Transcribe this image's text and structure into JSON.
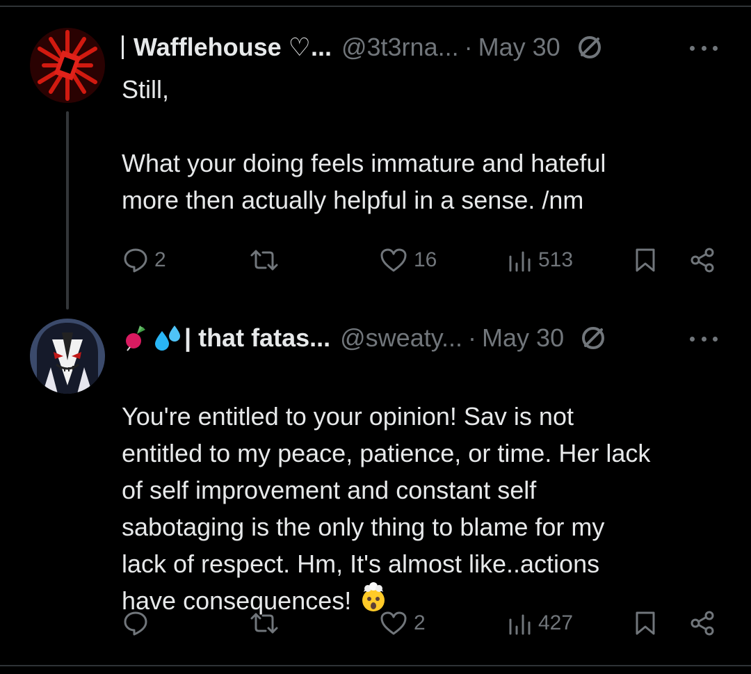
{
  "posts": [
    {
      "name": "Wafflehouse ♡...",
      "handle": "@3t3rna...",
      "separator": "·",
      "date": "May 30",
      "text": "Still,\n\nWhat your doing feels immature and hateful\nmore then actually helpful in a sense. /nm",
      "replies": "2",
      "reposts": "",
      "likes": "16",
      "views": "513"
    },
    {
      "name": "| that fatas...",
      "handle": "@sweaty...",
      "separator": "·",
      "date": "May 30",
      "text": "You're entitled to your opinion! Sav is not\nentitled to my peace, patience, or time. Her lack\nof self improvement and constant self\nsabotaging is the only thing to blame for my\nlack of respect. Hm, It's almost like..actions\nhave consequences!",
      "replies": "",
      "reposts": "",
      "likes": "2",
      "views": "427"
    }
  ],
  "icons": {
    "reply": "speech-bubble",
    "repost": "repost-arrows",
    "like": "heart",
    "views": "bar-chart",
    "bookmark": "bookmark",
    "share": "share-nodes",
    "more": "three-dots",
    "blocked": "no-entry-circle",
    "name_emojis": [
      "radish-emoji",
      "sweat-droplets-emoji"
    ],
    "end_emoji": "exploding-head-emoji"
  },
  "colors": {
    "background": "#000000",
    "text": "#e7e9ea",
    "secondary": "#71767b",
    "avatar_red": "#c0120c"
  }
}
